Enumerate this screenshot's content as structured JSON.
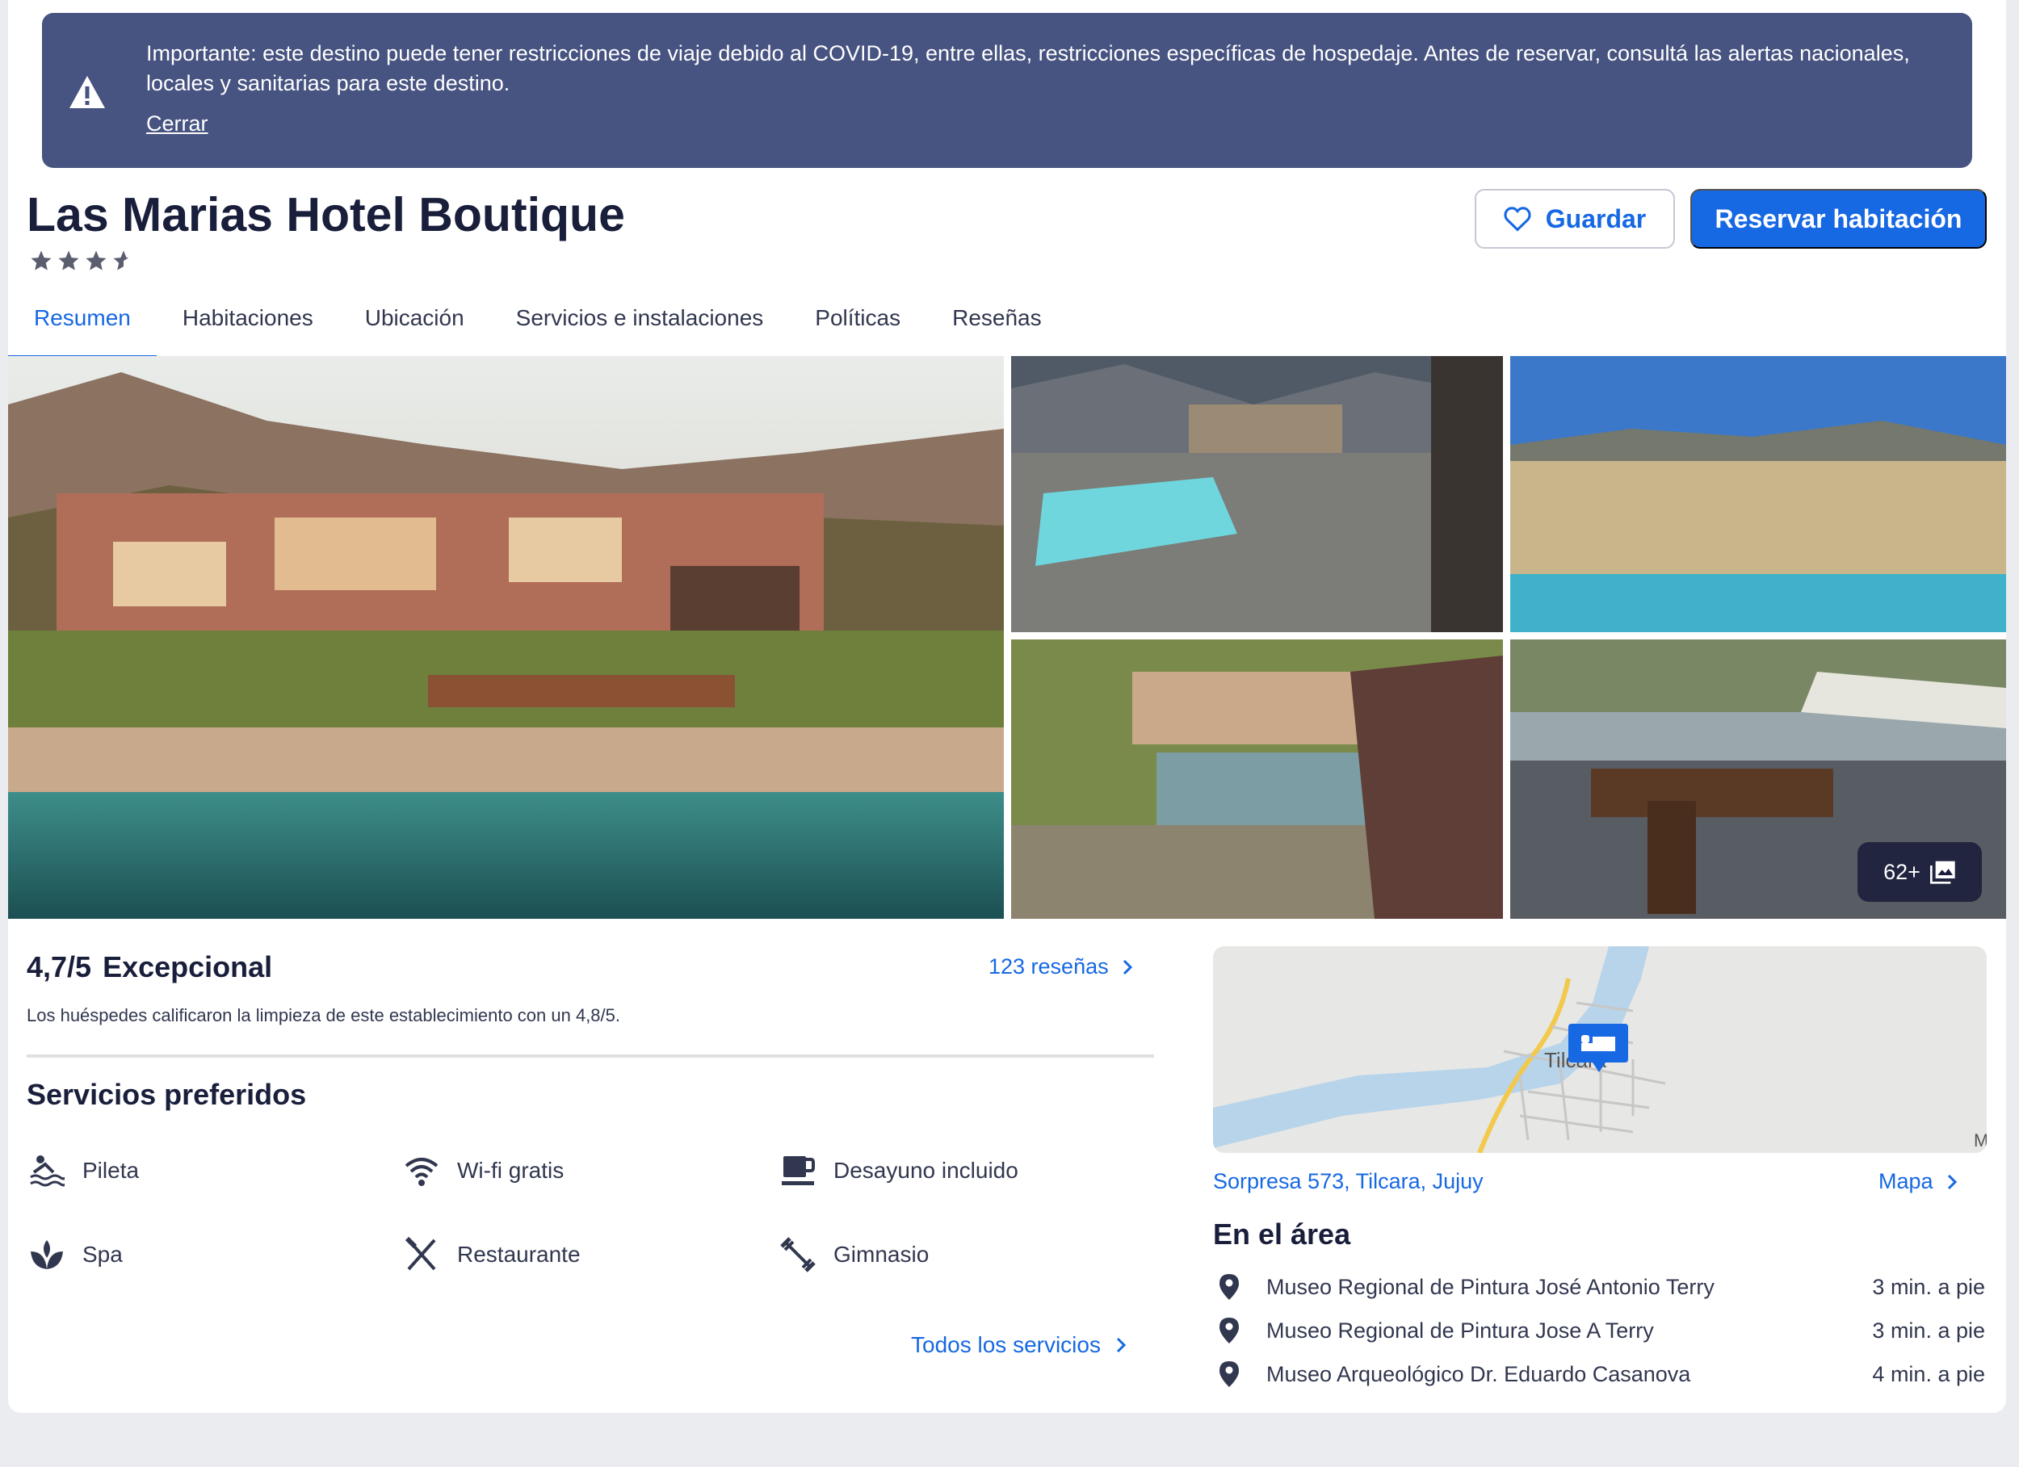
{
  "banner": {
    "message": "Importante: este destino puede tener restricciones de viaje debido al COVID-19, entre ellas, restricciones específicas de hospedaje. Antes de reservar, consultá las alertas nacionales, locales y sanitarias para este destino.",
    "close_label": "Cerrar",
    "icon": "warning-icon"
  },
  "hotel": {
    "name": "Las Marias Hotel Boutique",
    "star_rating": 3.5
  },
  "actions": {
    "save_label": "Guardar",
    "book_label": "Reservar habitación"
  },
  "tabs": [
    {
      "label": "Resumen",
      "active": true
    },
    {
      "label": "Habitaciones",
      "active": false
    },
    {
      "label": "Ubicación",
      "active": false
    },
    {
      "label": "Servicios e instalaciones",
      "active": false
    },
    {
      "label": "Políticas",
      "active": false
    },
    {
      "label": "Reseñas",
      "active": false
    }
  ],
  "gallery": {
    "photo_count_label": "62+"
  },
  "rating": {
    "score": "4,7/5",
    "label": "Excepcional",
    "reviews_link": "123 reseñas",
    "cleanliness_note": "Los huéspedes calificaron la limpieza de este establecimiento con un 4,8/5."
  },
  "amenities": {
    "heading": "Servicios preferidos",
    "items": [
      {
        "label": "Pileta",
        "icon": "pool-icon"
      },
      {
        "label": "Wi-fi gratis",
        "icon": "wifi-icon"
      },
      {
        "label": "Desayuno incluido",
        "icon": "breakfast-icon"
      },
      {
        "label": "Spa",
        "icon": "spa-icon"
      },
      {
        "label": "Restaurante",
        "icon": "restaurant-icon"
      },
      {
        "label": "Gimnasio",
        "icon": "gym-icon"
      }
    ],
    "all_link": "Todos los servicios"
  },
  "location": {
    "map_town_label": "Tilcara",
    "map_corner_label": "M",
    "address": "Sorpresa 573, Tilcara, Jujuy",
    "map_link": "Mapa",
    "area_heading": "En el área",
    "points": [
      {
        "name": "Museo Regional de Pintura José Antonio Terry",
        "time": "3 min. a pie"
      },
      {
        "name": "Museo Regional de Pintura Jose A Terry",
        "time": "3 min. a pie"
      },
      {
        "name": "Museo Arqueológico Dr. Eduardo Casanova",
        "time": "4 min. a pie"
      }
    ]
  },
  "colors": {
    "primary": "#1668e3",
    "banner": "#475380",
    "text": "#191e3b"
  }
}
